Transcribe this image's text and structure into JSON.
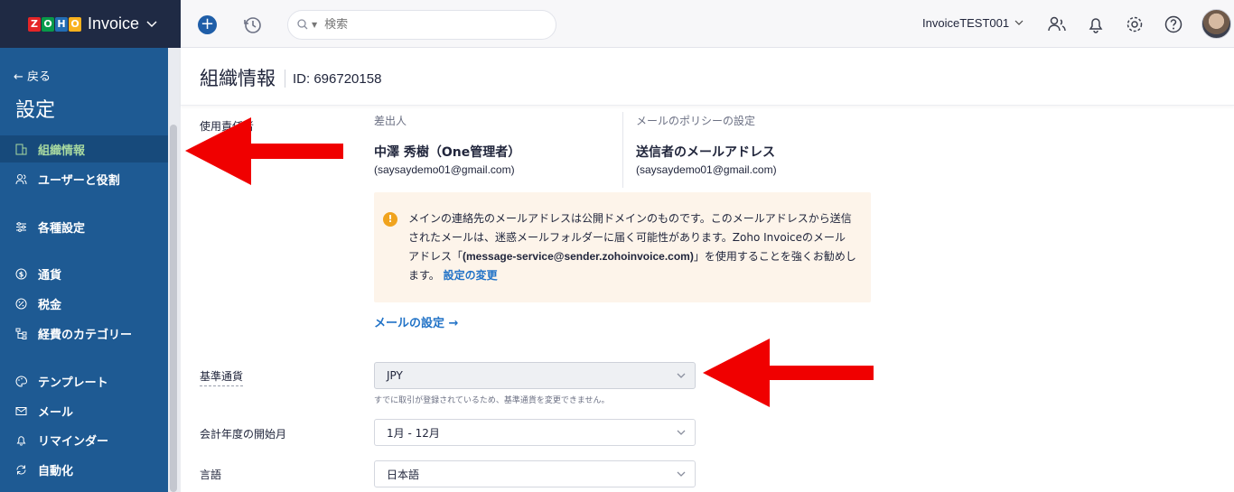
{
  "topbar": {
    "brand_letters": [
      "Z",
      "O",
      "H",
      "O"
    ],
    "app_name": "Invoice",
    "search_placeholder": "検索",
    "org_name": "InvoiceTEST001"
  },
  "sidebar": {
    "back_label": "← 戻る",
    "title": "設定",
    "items": [
      {
        "label": "組織情報",
        "icon": "building-icon",
        "active": true
      },
      {
        "label": "ユーザーと役割",
        "icon": "users-icon",
        "active": false
      },
      {
        "label": "各種設定",
        "icon": "sliders-icon",
        "active": false
      },
      {
        "label": "通貨",
        "icon": "currency-icon",
        "active": false
      },
      {
        "label": "税金",
        "icon": "percent-icon",
        "active": false
      },
      {
        "label": "経費のカテゴリー",
        "icon": "tree-icon",
        "active": false
      },
      {
        "label": "テンプレート",
        "icon": "palette-icon",
        "active": false
      },
      {
        "label": "メール",
        "icon": "mail-icon",
        "active": false
      },
      {
        "label": "リマインダー",
        "icon": "bell-icon",
        "active": false
      },
      {
        "label": "自動化",
        "icon": "refresh-icon",
        "active": false
      }
    ]
  },
  "page": {
    "title": "組織情報",
    "org_id": "ID: 696720158"
  },
  "form": {
    "contact_label": "使用責任者",
    "sender_label": "差出人",
    "sender_name": "中澤 秀樹（One管理者）",
    "sender_email": "(saysaydemo01@gmail.com)",
    "policy_label": "メールのポリシーの設定",
    "policy_name": "送信者のメールアドレス",
    "policy_email": "(saysaydemo01@gmail.com)",
    "warning_pre": "メインの連絡先のメールアドレスは公開ドメインのものです。このメールアドレスから送信されたメールは、迷惑メールフォルダーに届く可能性があります。Zoho Invoiceのメールアドレス「",
    "warning_bold": "(message-service@sender.zohoinvoice.com)",
    "warning_post": "」を使用することを強くお勧めします。",
    "warning_link": "設定の変更",
    "mail_settings_link": "メールの設定 →",
    "base_currency_label": "基準通貨",
    "base_currency_value": "JPY",
    "base_currency_hint": "すでに取引が登録されているため、基準通貨を変更できません。",
    "fiscal_year_label": "会計年度の開始月",
    "fiscal_year_value": "1月 - 12月",
    "language_label": "言語",
    "language_value": "日本語"
  },
  "colors": {
    "sidebar_bg": "#1e5a93",
    "active_text": "#a8d9a0",
    "link": "#2273c7",
    "warning_bg": "#fdf4ea",
    "annotation_arrow": "#f00000"
  }
}
